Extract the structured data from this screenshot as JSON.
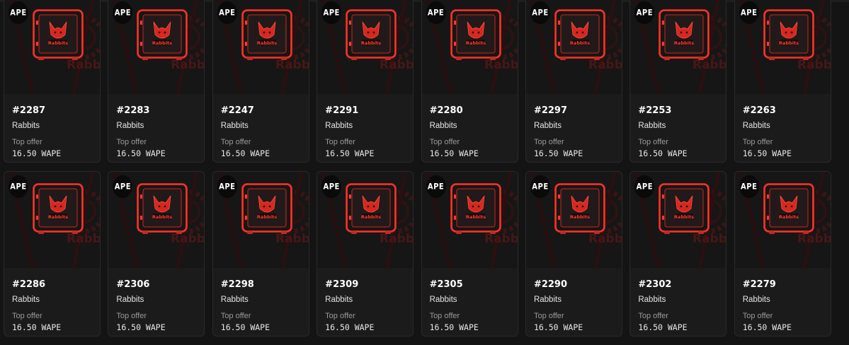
{
  "badge_label": "APE",
  "offer_label": "Top offer",
  "colors": {
    "background": "#141414",
    "card": "#1b1b1b",
    "accent_red": "#e0231c"
  },
  "icons": {
    "badge": "ape-chain-icon",
    "artwork": "rabbits-safe-artwork"
  },
  "items": [
    {
      "id": "#2287",
      "collection": "Rabbits",
      "price": "16.50 WAPE"
    },
    {
      "id": "#2283",
      "collection": "Rabbits",
      "price": "16.50 WAPE"
    },
    {
      "id": "#2247",
      "collection": "Rabbits",
      "price": "16.50 WAPE"
    },
    {
      "id": "#2291",
      "collection": "Rabbits",
      "price": "16.50 WAPE"
    },
    {
      "id": "#2280",
      "collection": "Rabbits",
      "price": "16.50 WAPE"
    },
    {
      "id": "#2297",
      "collection": "Rabbits",
      "price": "16.50 WAPE"
    },
    {
      "id": "#2253",
      "collection": "Rabbits",
      "price": "16.50 WAPE"
    },
    {
      "id": "#2263",
      "collection": "Rabbits",
      "price": "16.50 WAPE"
    },
    {
      "id": "#2286",
      "collection": "Rabbits",
      "price": "16.50 WAPE"
    },
    {
      "id": "#2306",
      "collection": "Rabbits",
      "price": "16.50 WAPE"
    },
    {
      "id": "#2298",
      "collection": "Rabbits",
      "price": "16.50 WAPE"
    },
    {
      "id": "#2309",
      "collection": "Rabbits",
      "price": "16.50 WAPE"
    },
    {
      "id": "#2305",
      "collection": "Rabbits",
      "price": "16.50 WAPE"
    },
    {
      "id": "#2290",
      "collection": "Rabbits",
      "price": "16.50 WAPE"
    },
    {
      "id": "#2302",
      "collection": "Rabbits",
      "price": "16.50 WAPE"
    },
    {
      "id": "#2279",
      "collection": "Rabbits",
      "price": "16.50 WAPE"
    }
  ]
}
